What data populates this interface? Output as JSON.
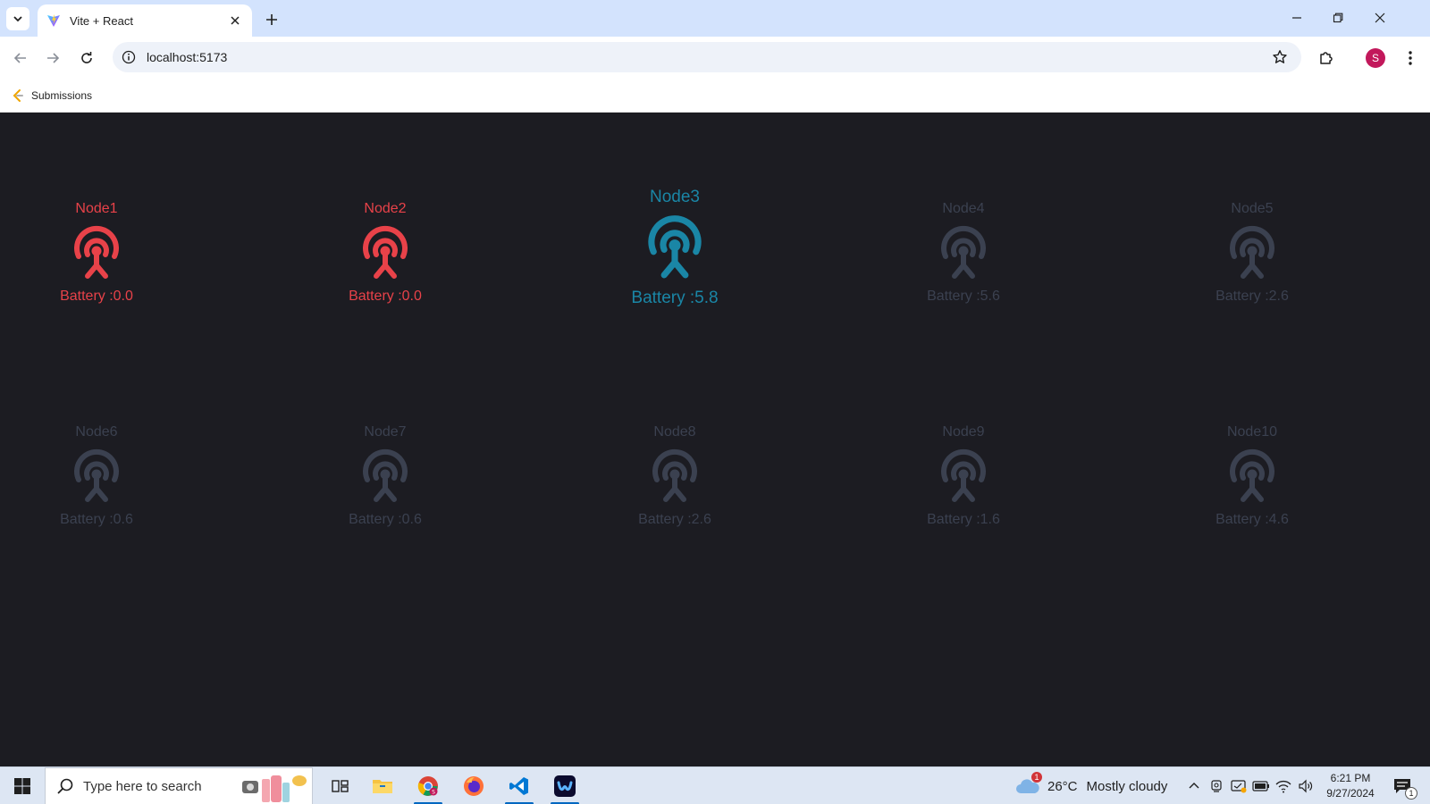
{
  "browser": {
    "tab": {
      "title": "Vite + React"
    },
    "address": {
      "url": "localhost:5173"
    },
    "bookmarks": [
      {
        "label": "Submissions"
      }
    ],
    "profile_initial": "S"
  },
  "colors": {
    "offline": "#e84249",
    "active": "#1a86a6",
    "idle": "#3b4150",
    "page_background": "#1c1c22"
  },
  "nodes": [
    {
      "name": "Node1",
      "battery": "Battery :0.0",
      "status": "offline",
      "icon": "antenna-signal-icon"
    },
    {
      "name": "Node2",
      "battery": "Battery :0.0",
      "status": "offline",
      "icon": "antenna-signal-icon"
    },
    {
      "name": "Node3",
      "battery": "Battery :5.8",
      "status": "active",
      "icon": "antenna-signal-icon"
    },
    {
      "name": "Node4",
      "battery": "Battery :5.6",
      "status": "idle",
      "icon": "antenna-signal-icon"
    },
    {
      "name": "Node5",
      "battery": "Battery :2.6",
      "status": "idle",
      "icon": "antenna-signal-icon"
    },
    {
      "name": "Node6",
      "battery": "Battery :0.6",
      "status": "idle",
      "icon": "antenna-signal-icon"
    },
    {
      "name": "Node7",
      "battery": "Battery :0.6",
      "status": "idle",
      "icon": "antenna-signal-icon"
    },
    {
      "name": "Node8",
      "battery": "Battery :2.6",
      "status": "idle",
      "icon": "antenna-signal-icon"
    },
    {
      "name": "Node9",
      "battery": "Battery :1.6",
      "status": "idle",
      "icon": "antenna-signal-icon"
    },
    {
      "name": "Node10",
      "battery": "Battery :4.6",
      "status": "idle",
      "icon": "antenna-signal-icon"
    }
  ],
  "taskbar": {
    "search_placeholder": "Type here to search",
    "weather": {
      "temp": "26°C",
      "condition": "Mostly cloudy",
      "alert_count": "1"
    },
    "clock": {
      "time": "6:21 PM",
      "date": "9/27/2024"
    },
    "notification_count": "1",
    "apps": [
      "task-view-icon",
      "file-explorer-icon",
      "chrome-icon",
      "firefox-icon",
      "vscode-icon",
      "webex-icon"
    ]
  }
}
